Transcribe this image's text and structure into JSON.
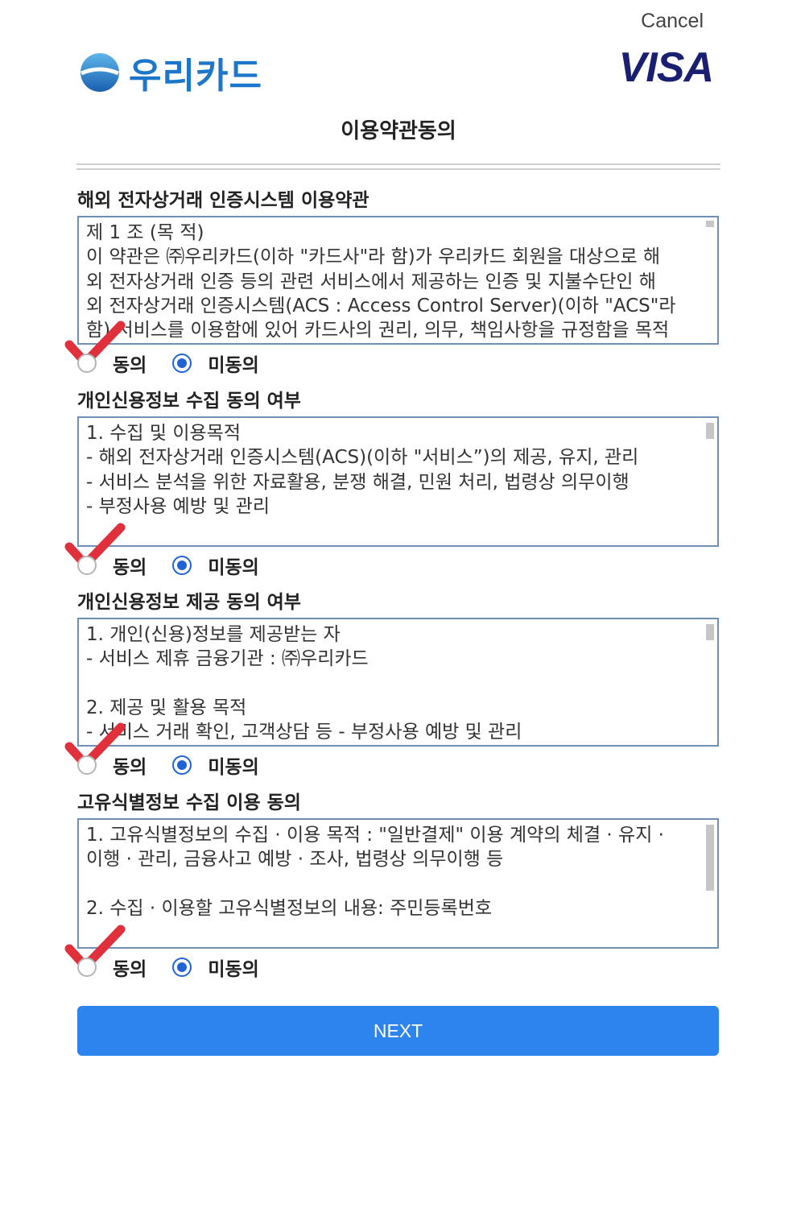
{
  "header": {
    "cancel_label": "Cancel",
    "brand_name": "우리카드",
    "network_logo": "VISA",
    "page_title": "이용약관동의"
  },
  "sections": [
    {
      "title": "해외 전자상거래 인증시스템 이용약관",
      "lines": [
        "제 1 조 (목 적)",
        "이 약관은 ㈜우리카드(이하 \"카드사\"라 함)가 우리카드 회원을 대상으로 해",
        "외 전자상거래 인증 등의 관련 서비스에서 제공하는 인증 및 지불수단인 해",
        "외 전자상거래 인증시스템(ACS : Access Control Server)(이하 \"ACS\"라",
        "함) 서비스를 이용함에 있어 카드사의 권리, 의무, 책임사항을 규정함을 목적"
      ],
      "agree_label": "동의",
      "disagree_label": "미동의",
      "selected": "disagree"
    },
    {
      "title": "개인신용정보 수집 동의 여부",
      "lines": [
        "1. 수집 및 이용목적",
        "- 해외 전자상거래 인증시스템(ACS)(이하 \"서비스”)의 제공, 유지, 관리",
        "- 서비스 분석을 위한 자료활용, 분쟁 해결, 민원 처리, 법령상 의무이행",
        "- 부정사용 예방 및 관리"
      ],
      "agree_label": "동의",
      "disagree_label": "미동의",
      "selected": "disagree"
    },
    {
      "title": "개인신용정보 제공 동의 여부",
      "lines": [
        "1. 개인(신용)정보를 제공받는 자",
        "- 서비스 제휴 금융기관 : ㈜우리카드",
        "",
        "2. 제공 및 활용 목적",
        "- 서비스 거래 확인, 고객상담 등 - 부정사용 예방 및 관리"
      ],
      "agree_label": "동의",
      "disagree_label": "미동의",
      "selected": "disagree"
    },
    {
      "title": "고유식별정보 수집 이용 동의",
      "lines": [
        "1. 고유식별정보의 수집 · 이용 목적 : \"일반결제\" 이용 계약의 체결 · 유지 ·",
        "이행 · 관리, 금융사고 예방 · 조사, 법령상 의무이행 등",
        "",
        "2. 수집 · 이용할 고유식별정보의 내용: 주민등록번호"
      ],
      "agree_label": "동의",
      "disagree_label": "미동의",
      "selected": "disagree"
    }
  ],
  "next_label": "NEXT",
  "colors": {
    "brand_blue": "#1c76c9",
    "visa_navy": "#1a1f71",
    "button_blue": "#2d84ef",
    "radio_blue": "#1f63d6",
    "check_red": "#e0303c"
  }
}
